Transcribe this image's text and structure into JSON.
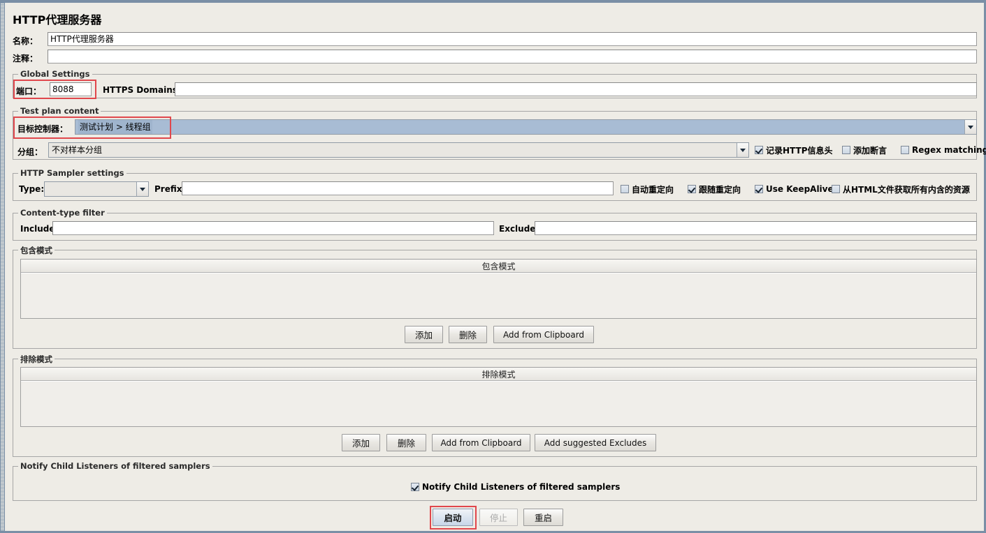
{
  "window": {
    "title": "HTTP代理服务器"
  },
  "fields": {
    "name_label": "名称：",
    "name_value": "HTTP代理服务器",
    "comment_label": "注释：",
    "comment_value": ""
  },
  "global_settings": {
    "title": "Global Settings",
    "port_label": "端口：",
    "port_value": "8088",
    "https_domains_label": "HTTPS Domains :",
    "https_domains_value": ""
  },
  "test_plan_content": {
    "title": "Test plan content",
    "target_controller_label": "目标控制器：",
    "target_controller_value": "测试计划 > 线程组",
    "grouping_label": "分组：",
    "grouping_value": "不对样本分组",
    "checkboxes": [
      {
        "label": "记录HTTP信息头",
        "checked": true
      },
      {
        "label": "添加断言",
        "checked": false
      },
      {
        "label": "Regex matching",
        "checked": false
      }
    ]
  },
  "http_sampler_settings": {
    "title": "HTTP Sampler settings",
    "type_label": "Type:",
    "type_value": "",
    "prefix_label": "Prefix:",
    "prefix_value": "",
    "checkboxes": [
      {
        "label": "自动重定向",
        "checked": false
      },
      {
        "label": "跟随重定向",
        "checked": true
      },
      {
        "label": "Use KeepAlive",
        "checked": true
      },
      {
        "label": "从HTML文件获取所有内含的资源",
        "checked": false
      }
    ]
  },
  "content_type_filter": {
    "title": "Content-type filter",
    "include_label": "Include:",
    "include_value": "",
    "exclude_label": "Exclude:",
    "exclude_value": ""
  },
  "include_patterns": {
    "title": "包含模式",
    "column_header": "包含模式",
    "rows": [],
    "buttons": [
      "添加",
      "删除",
      "Add from Clipboard"
    ]
  },
  "exclude_patterns": {
    "title": "排除模式",
    "column_header": "排除模式",
    "rows": [],
    "buttons": [
      "添加",
      "删除",
      "Add from Clipboard",
      "Add suggested Excludes"
    ]
  },
  "notify_child_listeners": {
    "title": "Notify Child Listeners of filtered samplers",
    "checkbox_label": "Notify Child Listeners of filtered samplers",
    "checked": true
  },
  "actions": {
    "start_label": "启动",
    "stop_label": "停止",
    "restart_label": "重启",
    "start_highlighted": true,
    "stop_disabled": true,
    "restart_disabled": false
  },
  "colors": {
    "annotation": "#e0474c",
    "panel_bg": "#eeece6",
    "frame": "#7a8fa6",
    "combo_selected": "#a8bcd4"
  }
}
